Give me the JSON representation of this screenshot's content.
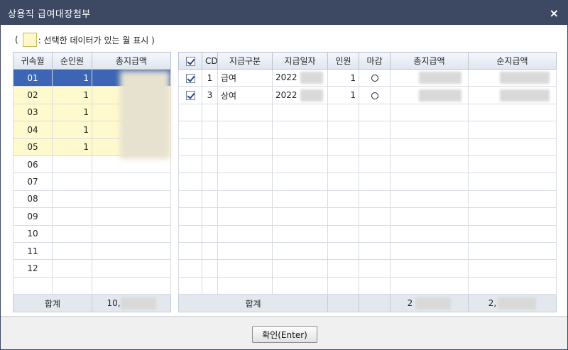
{
  "window": {
    "title": "상용직 급여대장첨부",
    "close_icon": "×"
  },
  "legend": {
    "open_paren": "(",
    "text": ": 선택한 데이터가 있는 월 표시 )",
    "swatch_color": "#fff8c8"
  },
  "left_table": {
    "headers": [
      "귀속월",
      "순인원",
      "총지급액"
    ],
    "rows": [
      {
        "month": "01",
        "count": "1",
        "total": ""
      },
      {
        "month": "02",
        "count": "1",
        "total": ""
      },
      {
        "month": "03",
        "count": "1",
        "total": ""
      },
      {
        "month": "04",
        "count": "1",
        "total": ""
      },
      {
        "month": "05",
        "count": "1",
        "total": ""
      },
      {
        "month": "06",
        "count": "",
        "total": ""
      },
      {
        "month": "07",
        "count": "",
        "total": ""
      },
      {
        "month": "08",
        "count": "",
        "total": ""
      },
      {
        "month": "09",
        "count": "",
        "total": ""
      },
      {
        "month": "10",
        "count": "",
        "total": ""
      },
      {
        "month": "11",
        "count": "",
        "total": ""
      },
      {
        "month": "12",
        "count": "",
        "total": ""
      }
    ],
    "footer_label": "합계",
    "footer_total": "10,"
  },
  "right_table": {
    "headers": [
      "CD",
      "지급구분",
      "지급일자",
      "인원",
      "마감",
      "총지급액",
      "순지급액"
    ],
    "rows": [
      {
        "cd": "1",
        "type": "급여",
        "date": "2022",
        "count": "1",
        "closed_icon": "circle-icon"
      },
      {
        "cd": "3",
        "type": "상여",
        "date": "2022",
        "count": "1",
        "closed_icon": "circle-icon"
      }
    ],
    "footer_label": "합계",
    "footer_total": "2",
    "footer_net": "2,"
  },
  "buttons": {
    "confirm": "확인(Enter)"
  },
  "colors": {
    "titlebar": "#3d4963",
    "highlight_yellow": "#fffacd",
    "selected_row": "#3c66b5"
  }
}
